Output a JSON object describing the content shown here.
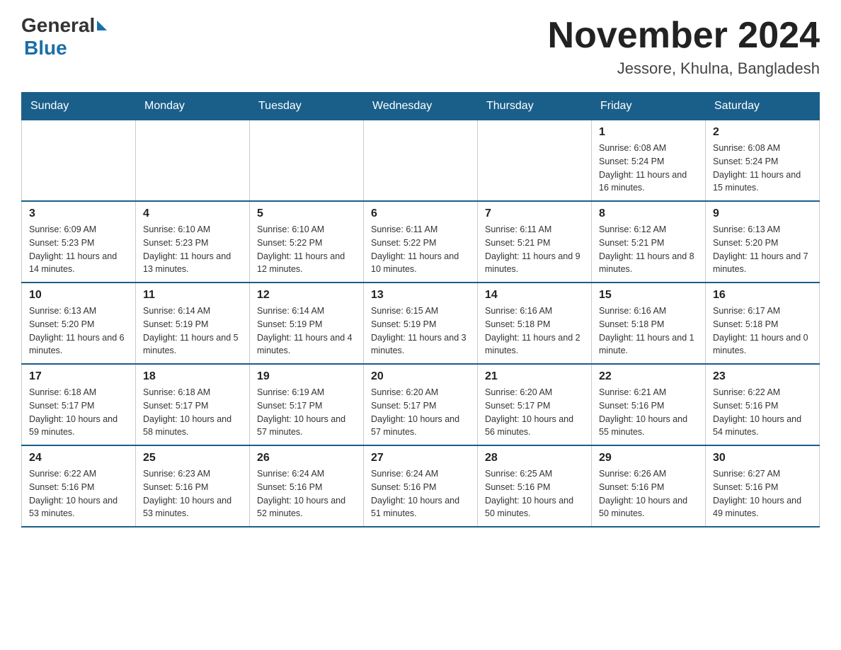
{
  "header": {
    "logo_general": "General",
    "logo_blue": "Blue",
    "month_year": "November 2024",
    "location": "Jessore, Khulna, Bangladesh"
  },
  "days_of_week": [
    "Sunday",
    "Monday",
    "Tuesday",
    "Wednesday",
    "Thursday",
    "Friday",
    "Saturday"
  ],
  "weeks": [
    [
      {
        "day": "",
        "info": ""
      },
      {
        "day": "",
        "info": ""
      },
      {
        "day": "",
        "info": ""
      },
      {
        "day": "",
        "info": ""
      },
      {
        "day": "",
        "info": ""
      },
      {
        "day": "1",
        "info": "Sunrise: 6:08 AM\nSunset: 5:24 PM\nDaylight: 11 hours and 16 minutes."
      },
      {
        "day": "2",
        "info": "Sunrise: 6:08 AM\nSunset: 5:24 PM\nDaylight: 11 hours and 15 minutes."
      }
    ],
    [
      {
        "day": "3",
        "info": "Sunrise: 6:09 AM\nSunset: 5:23 PM\nDaylight: 11 hours and 14 minutes."
      },
      {
        "day": "4",
        "info": "Sunrise: 6:10 AM\nSunset: 5:23 PM\nDaylight: 11 hours and 13 minutes."
      },
      {
        "day": "5",
        "info": "Sunrise: 6:10 AM\nSunset: 5:22 PM\nDaylight: 11 hours and 12 minutes."
      },
      {
        "day": "6",
        "info": "Sunrise: 6:11 AM\nSunset: 5:22 PM\nDaylight: 11 hours and 10 minutes."
      },
      {
        "day": "7",
        "info": "Sunrise: 6:11 AM\nSunset: 5:21 PM\nDaylight: 11 hours and 9 minutes."
      },
      {
        "day": "8",
        "info": "Sunrise: 6:12 AM\nSunset: 5:21 PM\nDaylight: 11 hours and 8 minutes."
      },
      {
        "day": "9",
        "info": "Sunrise: 6:13 AM\nSunset: 5:20 PM\nDaylight: 11 hours and 7 minutes."
      }
    ],
    [
      {
        "day": "10",
        "info": "Sunrise: 6:13 AM\nSunset: 5:20 PM\nDaylight: 11 hours and 6 minutes."
      },
      {
        "day": "11",
        "info": "Sunrise: 6:14 AM\nSunset: 5:19 PM\nDaylight: 11 hours and 5 minutes."
      },
      {
        "day": "12",
        "info": "Sunrise: 6:14 AM\nSunset: 5:19 PM\nDaylight: 11 hours and 4 minutes."
      },
      {
        "day": "13",
        "info": "Sunrise: 6:15 AM\nSunset: 5:19 PM\nDaylight: 11 hours and 3 minutes."
      },
      {
        "day": "14",
        "info": "Sunrise: 6:16 AM\nSunset: 5:18 PM\nDaylight: 11 hours and 2 minutes."
      },
      {
        "day": "15",
        "info": "Sunrise: 6:16 AM\nSunset: 5:18 PM\nDaylight: 11 hours and 1 minute."
      },
      {
        "day": "16",
        "info": "Sunrise: 6:17 AM\nSunset: 5:18 PM\nDaylight: 11 hours and 0 minutes."
      }
    ],
    [
      {
        "day": "17",
        "info": "Sunrise: 6:18 AM\nSunset: 5:17 PM\nDaylight: 10 hours and 59 minutes."
      },
      {
        "day": "18",
        "info": "Sunrise: 6:18 AM\nSunset: 5:17 PM\nDaylight: 10 hours and 58 minutes."
      },
      {
        "day": "19",
        "info": "Sunrise: 6:19 AM\nSunset: 5:17 PM\nDaylight: 10 hours and 57 minutes."
      },
      {
        "day": "20",
        "info": "Sunrise: 6:20 AM\nSunset: 5:17 PM\nDaylight: 10 hours and 57 minutes."
      },
      {
        "day": "21",
        "info": "Sunrise: 6:20 AM\nSunset: 5:17 PM\nDaylight: 10 hours and 56 minutes."
      },
      {
        "day": "22",
        "info": "Sunrise: 6:21 AM\nSunset: 5:16 PM\nDaylight: 10 hours and 55 minutes."
      },
      {
        "day": "23",
        "info": "Sunrise: 6:22 AM\nSunset: 5:16 PM\nDaylight: 10 hours and 54 minutes."
      }
    ],
    [
      {
        "day": "24",
        "info": "Sunrise: 6:22 AM\nSunset: 5:16 PM\nDaylight: 10 hours and 53 minutes."
      },
      {
        "day": "25",
        "info": "Sunrise: 6:23 AM\nSunset: 5:16 PM\nDaylight: 10 hours and 53 minutes."
      },
      {
        "day": "26",
        "info": "Sunrise: 6:24 AM\nSunset: 5:16 PM\nDaylight: 10 hours and 52 minutes."
      },
      {
        "day": "27",
        "info": "Sunrise: 6:24 AM\nSunset: 5:16 PM\nDaylight: 10 hours and 51 minutes."
      },
      {
        "day": "28",
        "info": "Sunrise: 6:25 AM\nSunset: 5:16 PM\nDaylight: 10 hours and 50 minutes."
      },
      {
        "day": "29",
        "info": "Sunrise: 6:26 AM\nSunset: 5:16 PM\nDaylight: 10 hours and 50 minutes."
      },
      {
        "day": "30",
        "info": "Sunrise: 6:27 AM\nSunset: 5:16 PM\nDaylight: 10 hours and 49 minutes."
      }
    ]
  ]
}
